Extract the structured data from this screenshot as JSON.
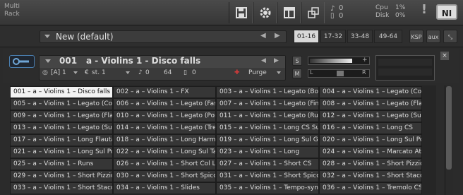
{
  "toolbar": {
    "midi_in": "0",
    "midi_out": "0",
    "cpu_label": "Cpu",
    "cpu_value": "1%",
    "disk_label": "Disk",
    "disk_value": "0%",
    "warning": "!",
    "logo": "NI"
  },
  "rack": {
    "label_line1": "Multi",
    "label_line2": "Rack",
    "preset_name": "New (default)",
    "pages": [
      "01-16",
      "17-32",
      "33-48",
      "49-64"
    ],
    "selected_page": "01-16",
    "ksp": "KSP",
    "aux": "aux"
  },
  "instrument": {
    "number": "001",
    "name": "a - Violins 1 - Disco falls",
    "output": "[A] 1",
    "midi": "st. 1",
    "voices": "0",
    "max_voices": "64",
    "memory": "0",
    "purge": "Purge",
    "solo": "S",
    "mute": "M",
    "pan_l": "L",
    "pan_r": "R",
    "accent": "#d23a3a"
  },
  "grid": {
    "cells": [
      "001 – a – Violins 1 – Disco falls",
      "002 – a – Violins 1 – FX",
      "003 – a – Violins 1 – Legato (Bou",
      "004 – a – Violins 1 – Legato (Con",
      "005 – a – Violins 1 – Legato (Con",
      "006 – a – Violins 1 – Legato (Fas",
      "007 – a – Violins 1 – Legato (Fing",
      "008 – a – Violins 1 – Legato (Flau",
      "009 – a – Violins 1 – Legato (Flau",
      "010 – a – Violins 1 – Legato (Port",
      "011 – a – Violins 1 – Legato (Runs",
      "012 – a – Violins 1 – Legato (Sul",
      "013 – a – Violins 1 – Legato (Sul F",
      "014 – a – Violins 1 – Legato (Trem",
      "015 – a – Violins 1 – Long CS Sul",
      "016 – a – Violins 1 – Long CS",
      "017 – a – Violins 1 – Long Flautan",
      "018 – a – Violins 1 – Long Harmor",
      "019 – a – Violins 1 – Long Sul G",
      "020 – a – Violins 1 – Long Sul Por",
      "021 – a – Violins 1 – Long Sul Pon",
      "022 – a – Violins 1 – Long Sul Ta:",
      "023 – a – Violins 1 – Long",
      "024 – a – Violins 1 – Marcato Att",
      "025 – a – Violins 1 – Runs",
      "026 – a – Violins 1 – Short Col Le",
      "027 – a – Violins 1 – Short CS",
      "028 – a – Violins 1 – Short Pizzic",
      "029 – a – Violins 1 – Short Pizzic",
      "030 – a – Violins 1 – Short Spicco",
      "031 – a – Violins 1 – Short Spicca",
      "032 – a – Violins 1 – Short Stacc",
      "033 – a – Violins 1 – Short Stacc",
      "034 – a – Violins 1 – Slides",
      "035 – a – Violins 1 – Tempo-sync",
      "036 – a – Violins 1 – Tremolo CS"
    ],
    "selected_index": 0
  }
}
